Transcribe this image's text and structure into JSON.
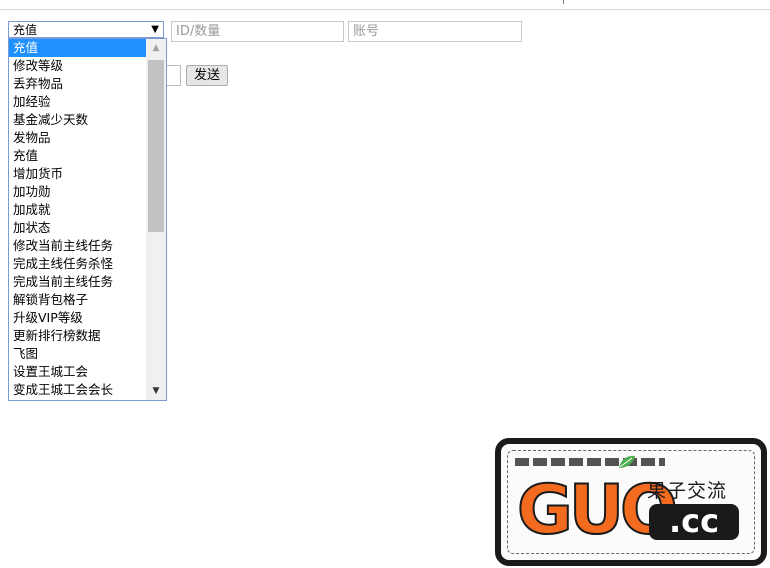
{
  "form": {
    "type_select": {
      "value": "充值"
    },
    "id_input": {
      "placeholder": "ID/数量"
    },
    "account_input": {
      "placeholder": "账号"
    },
    "send_button_label": "发送"
  },
  "dropdown": {
    "options": [
      "充值",
      "修改等级",
      "丢弃物品",
      "加经验",
      "基金减少天数",
      "发物品",
      "充值",
      "增加货币",
      "加功勋",
      "加成就",
      "加状态",
      "修改当前主线任务",
      "完成主线任务杀怪",
      "完成当前主线任务",
      "解锁背包格子",
      "升级VIP等级",
      "更新排行榜数据",
      "飞图",
      "设置王城工会",
      "变成王城工会会长"
    ],
    "selected_index": 0
  },
  "logo": {
    "brand": "GUO",
    "chinese": "果子交流",
    "domain": ".cc"
  }
}
